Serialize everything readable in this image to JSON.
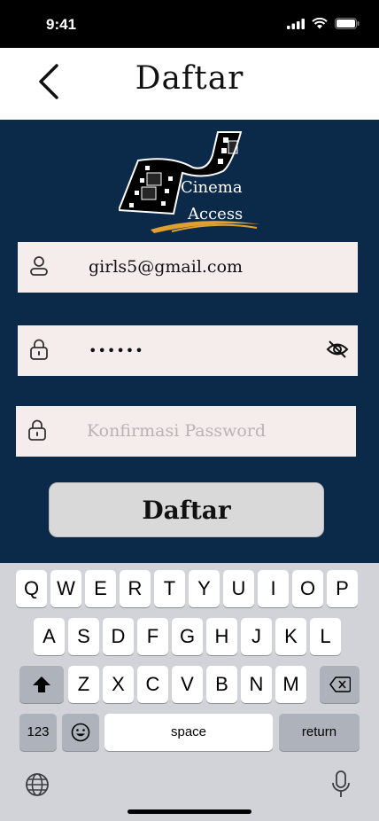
{
  "status_bar": {
    "time": "9:41"
  },
  "header": {
    "title": "Daftar",
    "back_icon": "chevron-left-icon"
  },
  "logo": {
    "line1": "Cinema",
    "line2": "Access",
    "icon": "film-strip-icon"
  },
  "form": {
    "email": {
      "value": "girls5@gmail.com",
      "icon": "user-icon"
    },
    "password": {
      "value": "••••••",
      "icon": "lock-icon",
      "toggle_icon": "eye-off-icon"
    },
    "confirm_password": {
      "placeholder": "Konfirmasi Password",
      "icon": "lock-icon"
    },
    "submit_label": "Daftar"
  },
  "keyboard": {
    "row1": [
      "Q",
      "W",
      "E",
      "R",
      "T",
      "Y",
      "U",
      "I",
      "O",
      "P"
    ],
    "row2": [
      "A",
      "S",
      "D",
      "F",
      "G",
      "H",
      "J",
      "K",
      "L"
    ],
    "row3": [
      "Z",
      "X",
      "C",
      "V",
      "B",
      "N",
      "M"
    ],
    "numbers_label": "123",
    "space_label": "space",
    "return_label": "return",
    "icons": [
      "shift-icon",
      "backspace-icon",
      "emoji-icon",
      "globe-icon",
      "microphone-icon"
    ]
  },
  "colors": {
    "background": "#0b2a4a",
    "field": "#f5ecec",
    "button": "#d9d9d9",
    "logo_accent": "#e0a030"
  }
}
